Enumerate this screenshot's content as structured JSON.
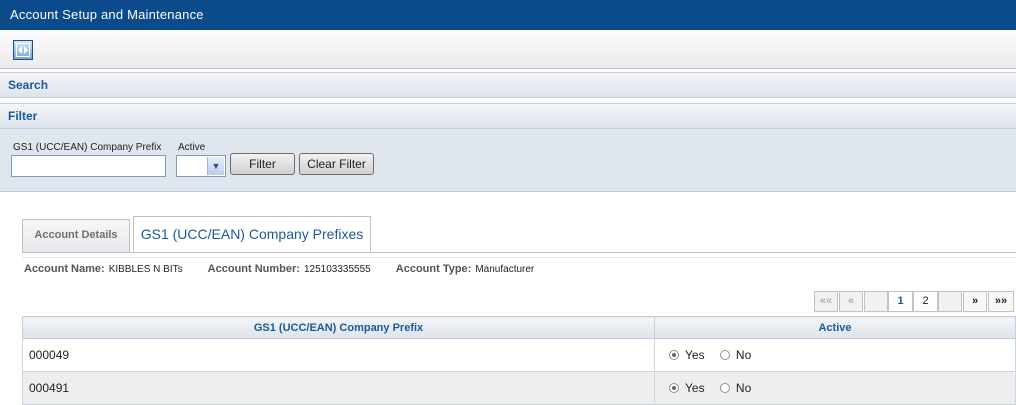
{
  "window": {
    "title": "Account Setup and Maintenance"
  },
  "sections": {
    "search": "Search",
    "filter": "Filter"
  },
  "filter": {
    "prefix_label": "GS1 (UCC/EAN) Company Prefix",
    "prefix_value": "",
    "active_label": "Active",
    "active_value": "",
    "filter_button": "Filter",
    "clear_button": "Clear Filter"
  },
  "tabs": [
    {
      "label": "Account Details",
      "active": false
    },
    {
      "label": "GS1 (UCC/EAN) Company Prefixes",
      "active": true
    }
  ],
  "account": {
    "name_label": "Account Name:",
    "name_value": "KIBBLES N BITs",
    "number_label": "Account Number:",
    "number_value": "125103335555",
    "type_label": "Account Type:",
    "type_value": "Manufacturer"
  },
  "pager": {
    "first": "««",
    "prev": "«",
    "pages": [
      "1",
      "2"
    ],
    "current": "1",
    "next": "»",
    "last": "»»"
  },
  "table": {
    "columns": [
      "GS1 (UCC/EAN) Company Prefix",
      "Active"
    ],
    "yes_label": "Yes",
    "no_label": "No",
    "rows": [
      {
        "prefix": "000049",
        "active": "Yes"
      },
      {
        "prefix": "000491",
        "active": "Yes"
      }
    ]
  },
  "icons": {
    "toolbar_button": "collapse-expand-icon",
    "select_arrow": "chevron-down-icon"
  }
}
